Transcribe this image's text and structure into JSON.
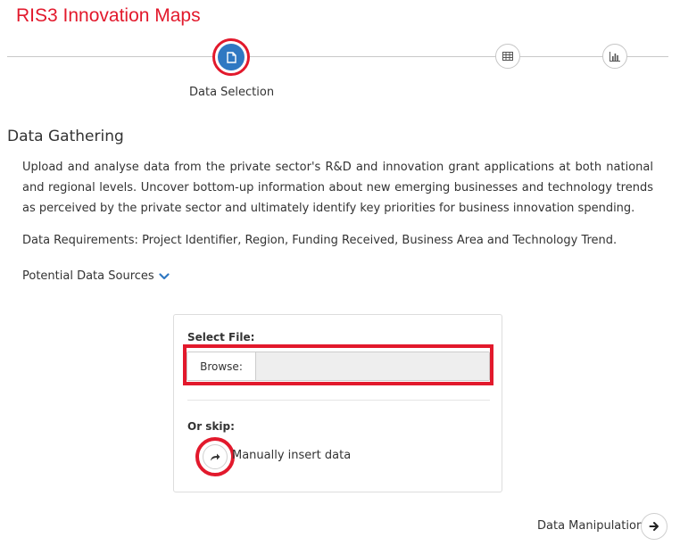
{
  "app": {
    "title": "RIS3 Innovation Maps"
  },
  "stepper": {
    "steps": [
      {
        "label": "Data Selection",
        "icon": "file-icon",
        "active": true
      },
      {
        "label": "",
        "icon": "table-icon",
        "active": false
      },
      {
        "label": "",
        "icon": "bar-chart-icon",
        "active": false
      }
    ]
  },
  "section": {
    "title": "Data Gathering",
    "description": "Upload and analyse data from the private sector's R&D and innovation grant applications at both national and regional levels. Uncover bottom-up information about new emerging businesses and technology trends as perceived by the private sector and ultimately identify key priorities for business innovation spending.",
    "requirements": "Data Requirements: Project Identifier, Region, Funding Received, Business Area and Technology Trend.",
    "sources_toggle": "Potential Data Sources"
  },
  "upload": {
    "select_label": "Select File:",
    "browse_label": "Browse:",
    "file_value": "",
    "skip_label": "Or skip:",
    "skip_action": "Manually insert data"
  },
  "navigation": {
    "next_label": "Data Manipulation"
  },
  "colors": {
    "brand": "#e2192c",
    "step_active": "#2f78c2",
    "chevron": "#2f78c2"
  }
}
